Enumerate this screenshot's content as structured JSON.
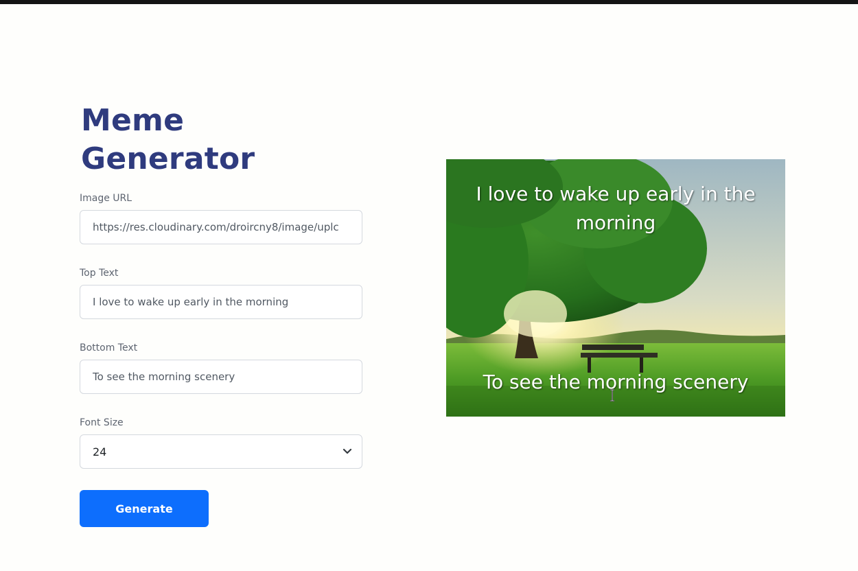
{
  "page": {
    "title": "Meme Generator"
  },
  "form": {
    "image_url": {
      "label": "Image URL",
      "value": "https://res.cloudinary.com/droircny8/image/uplc"
    },
    "top_text": {
      "label": "Top Text",
      "value": "I love to wake up early in the morning"
    },
    "bottom_text": {
      "label": "Bottom Text",
      "value": "To see the morning scenery"
    },
    "font_size": {
      "label": "Font Size",
      "selected": "24"
    },
    "generate_label": "Generate"
  },
  "meme": {
    "top_caption": "I love to wake up early in the morning",
    "bottom_caption": "To see the morning scenery",
    "scene": "sunlit tree with park bench on green meadow"
  },
  "colors": {
    "title": "#2f3b7e",
    "button": "#0d6efd",
    "background": "#fefefc"
  },
  "icons": {
    "select": "chevron-down-icon",
    "pointer": "text-cursor-icon"
  }
}
